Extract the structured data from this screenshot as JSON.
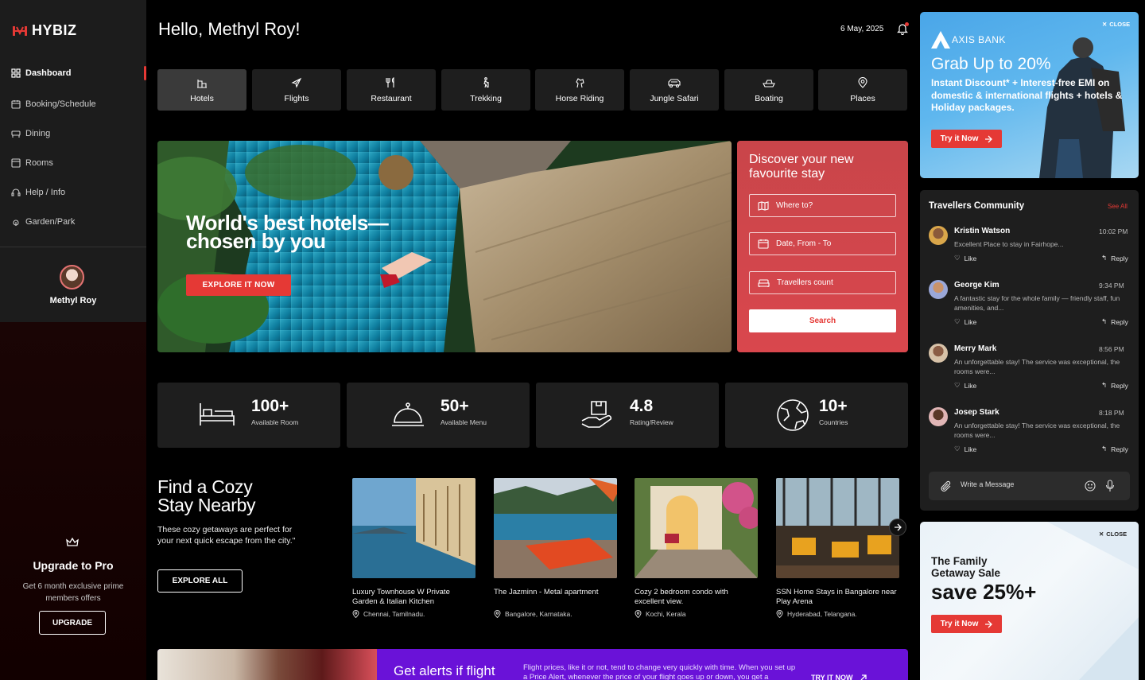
{
  "sidebar": {
    "logo": "HYBIZ",
    "items": [
      {
        "label": "Dashboard",
        "icon": "dashboard-icon"
      },
      {
        "label": "Booking/Schedule",
        "icon": "calendar-icon"
      },
      {
        "label": "Dining",
        "icon": "dining-icon"
      },
      {
        "label": "Rooms",
        "icon": "rooms-icon"
      },
      {
        "label": "Help / Info",
        "icon": "headset-icon"
      },
      {
        "label": "Garden/Park",
        "icon": "garden-icon"
      }
    ],
    "profile_name": "Methyl Roy",
    "upgrade": {
      "title": "Upgrade to Pro",
      "subtitle": "Get 6 month exclusive prime members offers",
      "button": "UPGRADE"
    }
  },
  "header": {
    "greeting": "Hello, Methyl Roy!",
    "date": "6 May, 2025"
  },
  "categories": [
    {
      "label": "Hotels",
      "icon": "hotel-icon",
      "active": true
    },
    {
      "label": "Flights",
      "icon": "plane-icon"
    },
    {
      "label": "Restaurant",
      "icon": "cutlery-icon"
    },
    {
      "label": "Trekking",
      "icon": "hiker-icon"
    },
    {
      "label": "Horse Riding",
      "icon": "horse-icon"
    },
    {
      "label": "Jungle Safari",
      "icon": "jeep-icon"
    },
    {
      "label": "Boating",
      "icon": "boat-icon"
    },
    {
      "label": "Places",
      "icon": "location-icon"
    }
  ],
  "hero": {
    "title_line1": "World's best hotels—",
    "title_line2": "chosen by you",
    "button": "EXPLORE IT NOW"
  },
  "booking": {
    "title_line1": "Discover your new",
    "title_line2": "favourite stay",
    "where_placeholder": "Where to?",
    "date_placeholder": "Date, From - To",
    "travellers_placeholder": "Travellers count",
    "search_button": "Search"
  },
  "stats": [
    {
      "value": "100+",
      "label": "Available Room",
      "icon": "bed-icon"
    },
    {
      "value": "50+",
      "label": "Available Menu",
      "icon": "cloche-icon"
    },
    {
      "value": "4.8",
      "label": "Rating/Review",
      "icon": "hand-box-icon"
    },
    {
      "value": "10+",
      "label": "Countries",
      "icon": "globe-icon"
    }
  ],
  "cozy": {
    "title_line1": "Find a Cozy",
    "title_line2": "Stay Nearby",
    "description": "These cozy getaways are perfect for your next quick escape from the city.\"",
    "button": "EXPLORE ALL",
    "cards": [
      {
        "title": "Luxury Townhouse W Private Garden & Italian Kitchen",
        "location": "Chennai, Tamilnadu."
      },
      {
        "title": "The Jazminn - Metal apartment",
        "location": "Bangalore, Karnataka."
      },
      {
        "title": "Cozy 2 bedroom condo with excellent view.",
        "location": "Kochi, Kerala"
      },
      {
        "title": "SSN Home Stays in Bangalore near Play Arena",
        "location": "Hyderabad, Telangana."
      }
    ]
  },
  "alert_banner": {
    "title": "Get alerts if flight",
    "text": "Flight prices, like it or not, tend to change very quickly with time. When you set up a Price Alert, whenever the price of your flight goes up or down, you get a",
    "cta": "TRY IT NOW"
  },
  "ad1": {
    "close": "CLOSE",
    "brand": "AXIS BANK",
    "title": "Grab Up to 20%",
    "text": "Instant Discount* + Interest-free EMI on domestic & international flights + hotels & Holiday packages.",
    "button": "Try it Now"
  },
  "community": {
    "title": "Travellers Community",
    "see_all": "See All",
    "comments": [
      {
        "name": "Kristin Watson",
        "time": "10:02 PM",
        "text": "Excellent Place to stay in Fairhope...",
        "like": "Like",
        "reply": "Reply",
        "color": "#d9a64a"
      },
      {
        "name": "George Kim",
        "time": "9:34 PM",
        "text": "A fantastic stay for the whole family — friendly staff, fun amenities, and...",
        "like": "Like",
        "reply": "Reply",
        "color": "#9aa7d8"
      },
      {
        "name": "Merry Mark",
        "time": "8:56 PM",
        "text": "An unforgettable stay! The service was exceptional, the rooms were...",
        "like": "Like",
        "reply": "Reply",
        "color": "#d7c2a8"
      },
      {
        "name": "Josep Stark",
        "time": "8:18 PM",
        "text": "An unforgettable stay! The service was exceptional, the rooms were...",
        "like": "Like",
        "reply": "Reply",
        "color": "#e0b5b5"
      }
    ],
    "message_placeholder": "Write a Message"
  },
  "ad2": {
    "close": "CLOSE",
    "title_line1": "The Family",
    "title_line2": "Getaway Sale",
    "big": "save 25%+",
    "button": "Try it Now"
  },
  "colors": {
    "accent": "#e53935",
    "booking_panel": "#d9474d",
    "alert_banner": "#6a12d8"
  }
}
